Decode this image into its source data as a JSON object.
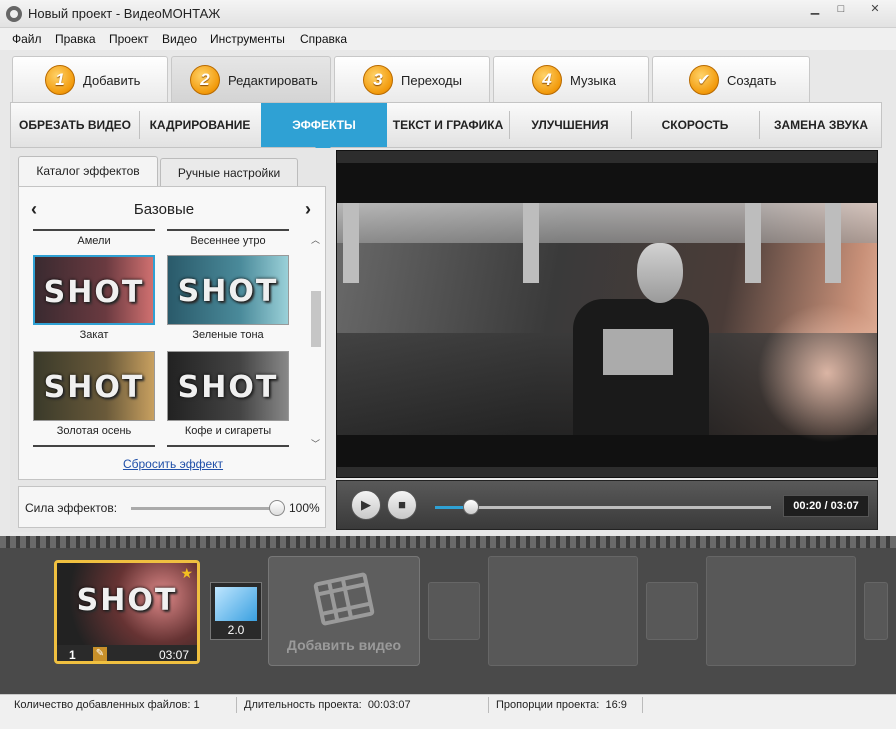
{
  "window": {
    "title": "Новый проект - ВидеоМОНТАЖ"
  },
  "menu": [
    "Файл",
    "Правка",
    "Проект",
    "Видео",
    "Инструменты",
    "Справка"
  ],
  "main_tabs": [
    {
      "num": "1",
      "label": "Добавить"
    },
    {
      "num": "2",
      "label": "Редактировать"
    },
    {
      "num": "3",
      "label": "Переходы"
    },
    {
      "num": "4",
      "label": "Музыка"
    },
    {
      "num": "",
      "label": "Создать"
    }
  ],
  "sub_tabs": [
    "ОБРЕЗАТЬ ВИДЕО",
    "КАДРИРОВАНИЕ",
    "ЭФФЕКТЫ",
    "ТЕКСТ И ГРАФИКА",
    "УЛУЧШЕНИЯ",
    "СКОРОСТЬ",
    "ЗАМЕНА ЗВУКА"
  ],
  "left_panel": {
    "tabs": [
      "Каталог эффектов",
      "Ручные настройки"
    ],
    "category": "Базовые",
    "prev_arrow": "‹",
    "next_arrow": "›",
    "top_labels": [
      "Амели",
      "Весеннее утро"
    ],
    "effects": [
      {
        "label": "Закат",
        "thumb_text": "SHOT"
      },
      {
        "label": "Зеленые тона",
        "thumb_text": "SHOT"
      },
      {
        "label": "Золотая осень",
        "thumb_text": "SHOT"
      },
      {
        "label": "Кофе и сигареты",
        "thumb_text": "SHOT"
      }
    ],
    "reset": "Сбросить эффект",
    "strength_label": "Сила эффектов:",
    "strength_value": "100%",
    "strength_fraction": 1.0
  },
  "player": {
    "time": "00:20 / 03:07",
    "progress_fraction": 0.107
  },
  "timeline": {
    "clip": {
      "index": "1",
      "duration": "03:07",
      "thumb_text": "SHOT"
    },
    "transition": {
      "label": "2.0"
    },
    "add_video": "Добавить видео"
  },
  "status": [
    {
      "label": "Количество добавленных файлов:",
      "value": "1"
    },
    {
      "label": "Длительность проекта:",
      "value": "00:03:07"
    },
    {
      "label": "Пропорции проекта:",
      "value": "16:9"
    }
  ],
  "colors": {
    "accent": "#2fa1d4",
    "tab_number": "#f29a0b",
    "clip_border": "#f0c040"
  }
}
